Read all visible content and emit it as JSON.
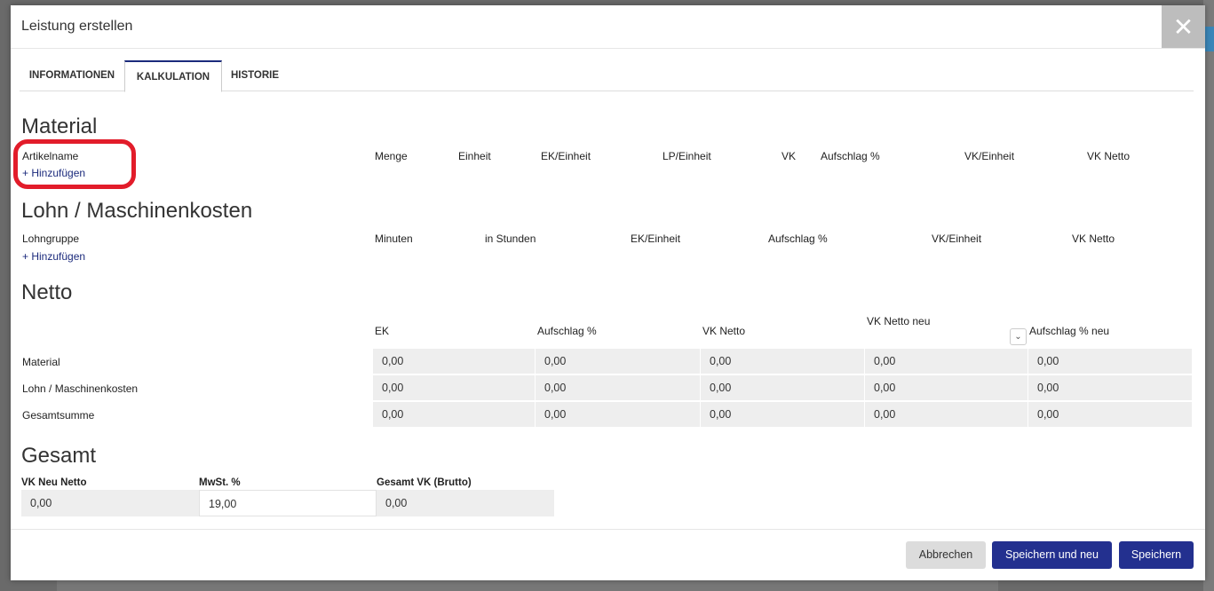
{
  "modal": {
    "title": "Leistung erstellen",
    "close_glyph": "✕"
  },
  "tabs": [
    "INFORMATIONEN",
    "KALKULATION",
    "HISTORIE"
  ],
  "material": {
    "title": "Material",
    "columns": [
      "Artikelname",
      "Menge",
      "Einheit",
      "EK/Einheit",
      "LP/Einheit",
      "VK",
      "Aufschlag %",
      "VK/Einheit",
      "VK Netto"
    ],
    "add_label": "+ Hinzufügen"
  },
  "lohn": {
    "title": "Lohn / Maschinenkosten",
    "columns": [
      "Lohngruppe",
      "Minuten",
      "in Stunden",
      "EK/Einheit",
      "Aufschlag %",
      "VK/Einheit",
      "VK Netto"
    ],
    "add_label": "+ Hinzufügen"
  },
  "netto": {
    "title": "Netto",
    "columns": [
      "EK",
      "Aufschlag %",
      "VK Netto",
      "VK Netto neu",
      "Aufschlag % neu"
    ],
    "rows": [
      {
        "label": "Material",
        "values": [
          "0,00",
          "0,00",
          "0,00",
          "0,00",
          "0,00"
        ]
      },
      {
        "label": "Lohn / Maschinenkosten",
        "values": [
          "0,00",
          "0,00",
          "0,00",
          "0,00",
          "0,00"
        ]
      },
      {
        "label": "Gesamtsumme",
        "values": [
          "0,00",
          "0,00",
          "0,00",
          "0,00",
          "0,00"
        ]
      }
    ],
    "chevron_glyph": "⌄"
  },
  "gesamt": {
    "title": "Gesamt",
    "fields": [
      {
        "label": "VK Neu Netto",
        "value": "0,00"
      },
      {
        "label": "MwSt. %",
        "value": "19,00"
      },
      {
        "label": "Gesamt VK (Brutto)",
        "value": "0,00"
      }
    ]
  },
  "footer": {
    "cancel_label": "Abbrechen",
    "save_new_label": "Speichern und neu",
    "save_label": "Speichern"
  },
  "colors": {
    "primary": "#23308f",
    "highlight_ring": "#e21c2a",
    "readonly_bg": "#eeeeee"
  }
}
